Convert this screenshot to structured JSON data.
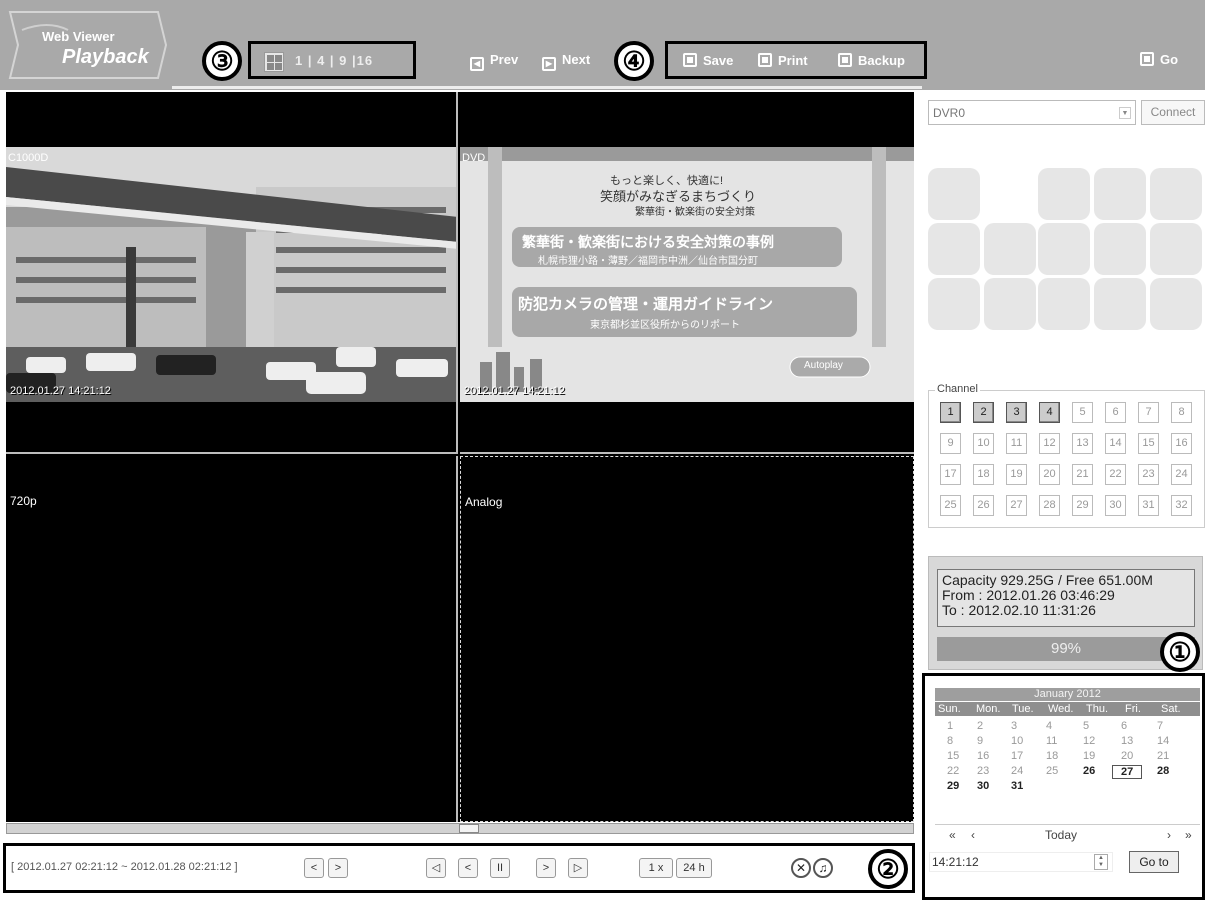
{
  "header": {
    "logo_line1": "Web Viewer",
    "logo_line2": "Playback",
    "split_label": "1 | 4 | 9 |16",
    "prev_label": "Prev",
    "next_label": "Next",
    "save_label": "Save",
    "print_label": "Print",
    "backup_label": "Backup",
    "go_label": "Go"
  },
  "callouts": {
    "c1": "①",
    "c2": "②",
    "c3": "③",
    "c4": "④"
  },
  "tiles": [
    {
      "label": "C1000D",
      "timestamp": "2012.01.27 14:21:12"
    },
    {
      "label": "DVD",
      "timestamp": "2012.01.27 14:21:12",
      "slide_line1": "もっと楽しく、快適に!",
      "slide_line2": "笑顔がみなぎるまちづくり",
      "slide_line3": "繁華街・歓楽街の安全対策",
      "slide_panel1": "繁華街・歓楽街における安全対策の事例",
      "slide_panel1_sub": "札幌市狸小路・薄野／福岡市中洲／仙台市国分町",
      "slide_panel2": "防犯カメラの管理・運用ガイドライン",
      "slide_panel2_sub": "東京都杉並区役所からのリポート",
      "slide_badge": "Autoplay"
    },
    {
      "label": "720p"
    },
    {
      "label": "Analog"
    }
  ],
  "controls": {
    "range": "[ 2012.01.27 02:21:12 ~ 2012.01.28 02:21:12 ]",
    "prev_range": "<",
    "next_range": ">",
    "step_back": "◁",
    "rewind": "<",
    "pause": "II",
    "play": ">",
    "step_fwd": "▷",
    "speed": "1 x",
    "span": "24 h"
  },
  "right_panel": {
    "dvr_value": "DVR0",
    "connect_label": "Connect",
    "channel_legend": "Channel",
    "channels": [
      "1",
      "2",
      "3",
      "4",
      "5",
      "6",
      "7",
      "8",
      "9",
      "10",
      "11",
      "12",
      "13",
      "14",
      "15",
      "16",
      "17",
      "18",
      "19",
      "20",
      "21",
      "22",
      "23",
      "24",
      "25",
      "26",
      "27",
      "28",
      "29",
      "30",
      "31",
      "32"
    ],
    "active_channels": [
      "1",
      "2",
      "3",
      "4"
    ],
    "capacity_line1": "Capacity 929.25G / Free 651.00M",
    "capacity_line2": "From  : 2012.01.26 03:46:29",
    "capacity_line3": "To  : 2012.02.10 11:31:26",
    "capacity_percent": "99%"
  },
  "calendar": {
    "title": "January 2012",
    "weekdays": [
      "Sun.",
      "Mon.",
      "Tue.",
      "Wed.",
      "Thu.",
      "Fri.",
      "Sat."
    ],
    "weeks": [
      [
        "1",
        "2",
        "3",
        "4",
        "5",
        "6",
        "7"
      ],
      [
        "8",
        "9",
        "10",
        "11",
        "12",
        "13",
        "14"
      ],
      [
        "15",
        "16",
        "17",
        "18",
        "19",
        "20",
        "21"
      ],
      [
        "22",
        "23",
        "24",
        "25",
        "26",
        "27",
        "28"
      ],
      [
        "29",
        "30",
        "31",
        "",
        "",
        "",
        ""
      ]
    ],
    "bold_days": [
      "26",
      "27",
      "28",
      "29",
      "30",
      "31"
    ],
    "selected_day": "27",
    "nav_first": "«",
    "nav_prev": "‹",
    "today_label": "Today",
    "nav_next": "›",
    "nav_last": "»",
    "time_value": "14:21:12",
    "goto_label": "Go to"
  }
}
